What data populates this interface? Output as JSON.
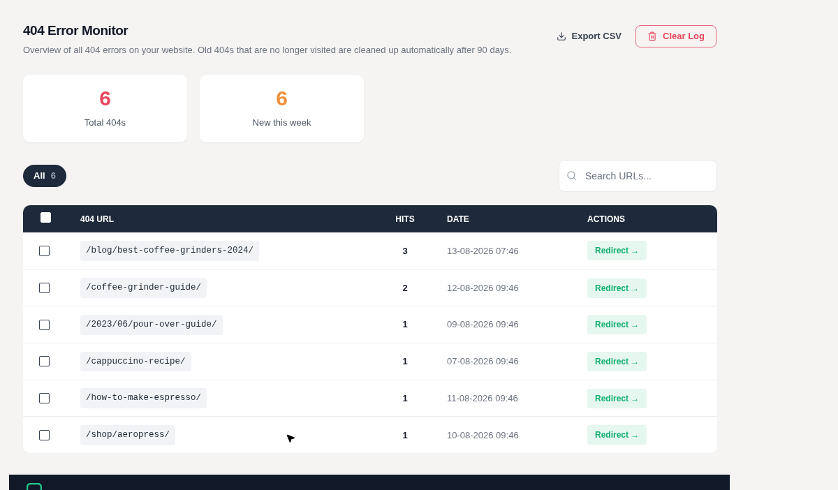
{
  "header": {
    "title": "404 Error Monitor",
    "subtitle": "Overview of all 404 errors on your website. Old 404s that are no longer visited are cleaned up automatically after 90 days.",
    "actions": [
      "Export CSV",
      "Clear Log"
    ]
  },
  "stats": [
    {
      "value": "6",
      "label": "Total 404s",
      "color": "#e8465c"
    },
    {
      "value": "6",
      "label": "New this week",
      "color": "#f0913a"
    }
  ],
  "filters": [
    {
      "label": "All",
      "count": "6",
      "selected": true
    }
  ],
  "search": {
    "placeholder": "Search URLs..."
  },
  "table": {
    "select_all_checked": false,
    "columns": [
      "404 URL",
      "HITS",
      "DATE",
      "ACTIONS"
    ],
    "rows": [
      {
        "checked": false,
        "url": "/blog/best-coffee-grinders-2024/",
        "hits": "3",
        "date": "13-08-2026 07:46",
        "action": "Redirect →"
      },
      {
        "checked": false,
        "url": "/coffee-grinder-guide/",
        "hits": "2",
        "date": "12-08-2026 09:46",
        "action": "Redirect →"
      },
      {
        "checked": false,
        "url": "/2023/06/pour-over-guide/",
        "hits": "1",
        "date": "09-08-2026 09:46",
        "action": "Redirect →"
      },
      {
        "checked": false,
        "url": "/cappuccino-recipe/",
        "hits": "1",
        "date": "07-08-2026 09:46",
        "action": "Redirect →"
      },
      {
        "checked": false,
        "url": "/how-to-make-espresso/",
        "hits": "1",
        "date": "11-08-2026 09:46",
        "action": "Redirect →"
      },
      {
        "checked": false,
        "url": "/shop/aeropress/",
        "hits": "1",
        "date": "10-08-2026 09:46",
        "action": "Redirect →"
      }
    ]
  }
}
